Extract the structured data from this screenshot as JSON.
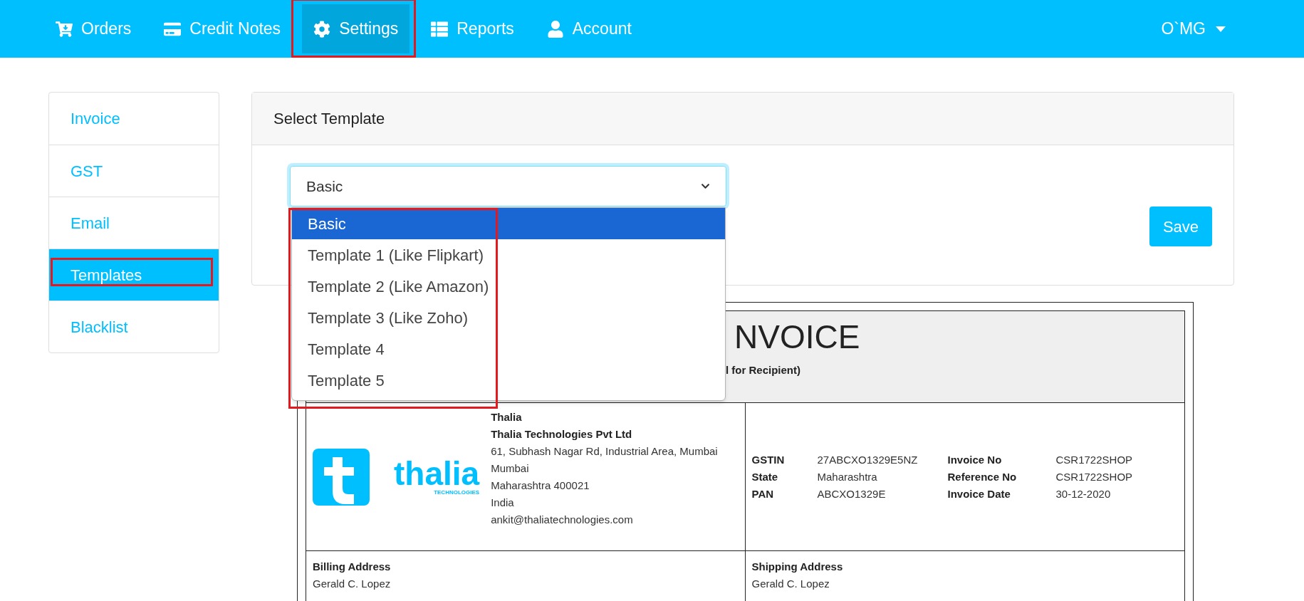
{
  "nav": {
    "items": [
      {
        "label": "Orders",
        "selected": false,
        "annotated": false
      },
      {
        "label": "Credit Notes",
        "selected": false,
        "annotated": false
      },
      {
        "label": "Settings",
        "selected": true,
        "annotated": true
      },
      {
        "label": "Reports",
        "selected": false,
        "annotated": false
      },
      {
        "label": "Account",
        "selected": false,
        "annotated": false
      }
    ],
    "user": "O`MG"
  },
  "sidebar": {
    "items": [
      {
        "label": "Invoice",
        "selected": false,
        "annotated": false
      },
      {
        "label": "GST",
        "selected": false,
        "annotated": false
      },
      {
        "label": "Email",
        "selected": false,
        "annotated": false
      },
      {
        "label": "Templates",
        "selected": true,
        "annotated": true
      },
      {
        "label": "Blacklist",
        "selected": false,
        "annotated": false
      }
    ]
  },
  "template_card": {
    "title": "Select Template",
    "select": {
      "value": "Basic",
      "expanded": true,
      "options_annotated": true,
      "options": [
        {
          "label": "Basic",
          "selected": true
        },
        {
          "label": "Template 1 (Like Flipkart)",
          "selected": false
        },
        {
          "label": "Template 2 (Like Amazon)",
          "selected": false
        },
        {
          "label": "Template 3 (Like Zoho)",
          "selected": false
        },
        {
          "label": "Template 4",
          "selected": false
        },
        {
          "label": "Template 5",
          "selected": false
        }
      ]
    },
    "save_button": "Save"
  },
  "invoice_preview": {
    "title": "NVOICE",
    "subtitle": "l for Recipient)",
    "company": {
      "logo_word": "thalia",
      "logo_tagline": "TECHNOLOGIES",
      "lines": [
        {
          "text": "Thalia",
          "bold": true
        },
        {
          "text": "Thalia Technologies Pvt Ltd",
          "bold": true
        },
        {
          "text": "61, Subhash Nagar Rd, Industrial Area, Mumbai",
          "bold": false
        },
        {
          "text": "Mumbai",
          "bold": false
        },
        {
          "text": "Maharashtra 400021",
          "bold": false
        },
        {
          "text": "India",
          "bold": false
        },
        {
          "text": "ankit@thaliatechnologies.com",
          "bold": false
        }
      ]
    },
    "details": [
      {
        "label": "GSTIN",
        "value": "27ABCXO1329E5NZ"
      },
      {
        "label": "Invoice No",
        "value": "CSR1722SHOP"
      },
      {
        "label": "State",
        "value": "Maharashtra"
      },
      {
        "label": "Reference No",
        "value": "CSR1722SHOP"
      },
      {
        "label": "PAN",
        "value": "ABCXO1329E"
      },
      {
        "label": "Invoice Date",
        "value": "30-12-2020"
      }
    ],
    "billing": {
      "heading": "Billing Address",
      "name": "Gerald C. Lopez"
    },
    "shipping": {
      "heading": "Shipping Address",
      "name": "Gerald C. Lopez"
    }
  }
}
